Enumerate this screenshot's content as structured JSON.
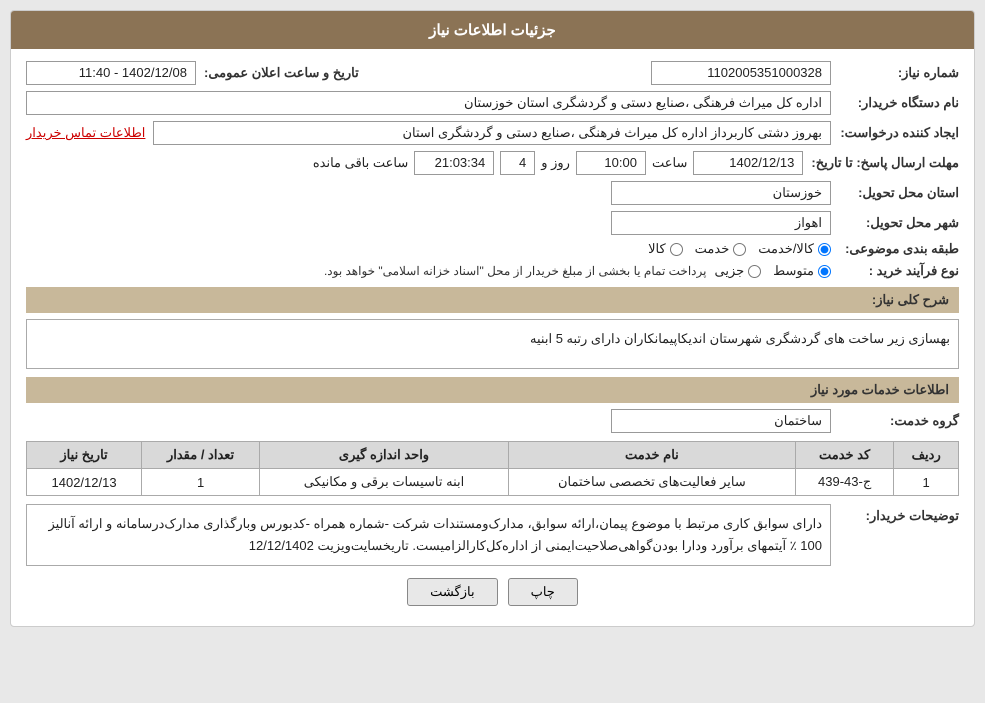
{
  "header": {
    "title": "جزئیات اطلاعات نیاز"
  },
  "fields": {
    "shomara_niaz_label": "شماره نیاز:",
    "shomara_niaz_value": "1102005351000328",
    "nam_dastgah_label": "نام دستگاه خریدار:",
    "nam_dastgah_value": "اداره کل میراث فرهنگی ،صنایع دستی و گردشگری استان خوزستان",
    "ijad_konande_label": "ایجاد کننده درخواست:",
    "ijad_konande_value": "بهروز دشتی کاربرداز اداره کل میراث فرهنگی ،صنایع دستی و گردشگری استان",
    "ettelaat_tamas_link": "اطلاعات تماس خریدار",
    "mohlat_label": "مهلت ارسال پاسخ: تا تاریخ:",
    "tarikh_value": "1402/12/13",
    "saat_label": "ساعت",
    "saat_value": "10:00",
    "roz_label": "روز و",
    "roz_value": "4",
    "baghimanda_label": "ساعت باقی مانده",
    "baghimanda_value": "21:03:34",
    "tarikh_elam_label": "تاریخ و ساعت اعلان عمومی:",
    "tarikh_elam_value": "1402/12/08 - 11:40",
    "ostan_label": "استان محل تحویل:",
    "ostan_value": "خوزستان",
    "shahr_label": "شهر محل تحویل:",
    "shahr_value": "اهواز",
    "tabaqe_label": "طبقه بندی موضوعی:",
    "tabaqe_options": [
      {
        "label": "کالا",
        "selected": false
      },
      {
        "label": "خدمت",
        "selected": false
      },
      {
        "label": "کالا/خدمت",
        "selected": true
      }
    ],
    "novoe_label": "نوع فرآیند خرید :",
    "novoe_options": [
      {
        "label": "جزیی",
        "selected": false
      },
      {
        "label": "متوسط",
        "selected": true
      }
    ],
    "novoe_notice": "پرداخت تمام یا بخشی از مبلغ خریدار از محل \"اسناد خزانه اسلامی\" خواهد بود.",
    "sharh_label": "شرح کلی نیاز:",
    "sharh_value": "بهسازی زیر ساخت های گردشگری شهرستان اندیکاپیمانکاران دارای رتبه 5 ابنیه",
    "khadamat_label": "اطلاعات خدمات مورد نیاز",
    "gorohe_label": "گروه خدمت:",
    "gorohe_value": "ساختمان",
    "table": {
      "headers": [
        "ردیف",
        "کد خدمت",
        "نام خدمت",
        "واحد اندازه گیری",
        "تعداد / مقدار",
        "تاریخ نیاز"
      ],
      "rows": [
        {
          "radif": "1",
          "kod_khadamat": "ج-43-439",
          "nam_khadamat": "سایر فعالیت‌های تخصصی ساختمان",
          "vahed": "ابنه تاسیسات برقی و مکانیکی",
          "tedad": "1",
          "tarikh": "1402/12/13"
        }
      ]
    },
    "toshihat_label": "توضیحات خریدار:",
    "toshihat_value": "دارای سوابق کاری مرتبط با موضوع پیمان،ارائه سوابق، مدارک‌ومستندات شرکت -شماره همراه -کدبورس وبارگذاری مدارک‌درسامانه و ارائه آنالیز 100 ٪ آیتمهای برآورد ودارا بودن‌گواهی‌صلاحیت‌ایمنی از اداره‌کل‌کار‌الزامیست. تاریخسایت‌ویزیت 12/12/1402"
  },
  "buttons": {
    "chap": "چاپ",
    "bazgasht": "بازگشت"
  }
}
